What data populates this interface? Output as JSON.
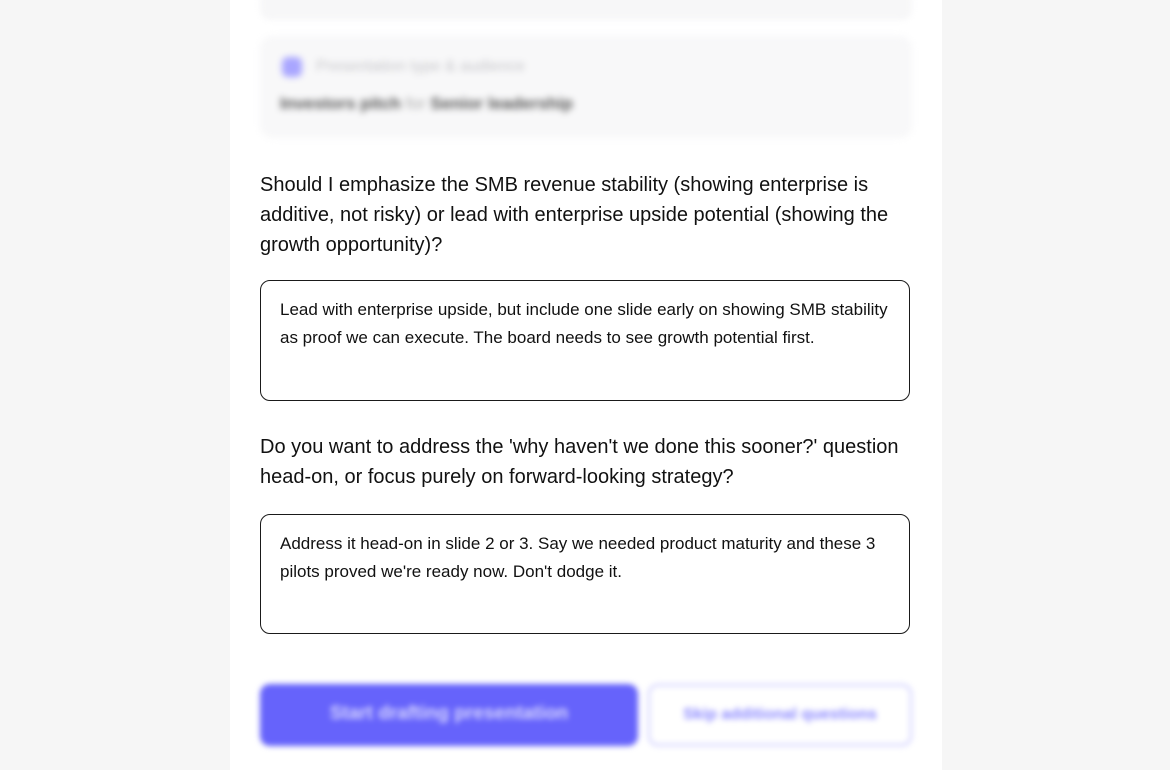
{
  "summary": {
    "top_strip_text": "",
    "type_label": "Presentation type & audience",
    "type_value": "Investors pitch",
    "type_connector": "for",
    "audience_value": "Senior leadership"
  },
  "questions": [
    {
      "question": "Should I emphasize the SMB revenue stability (showing enterprise is additive, not risky) or lead with enterprise upside potential (showing the growth opportunity)?",
      "answer": "Lead with enterprise upside, but include one slide early on showing SMB stability as proof we can execute. The board needs to see growth potential first."
    },
    {
      "question": "Do you want to address the 'why haven't we done this sooner?' question head-on, or focus purely on forward-looking strategy?",
      "answer": "Address it head-on in slide 2 or 3. Say we needed product maturity and these 3 pilots proved we're ready now. Don't dodge it."
    }
  ],
  "actions": {
    "primary_label": "Start drafting presentation",
    "secondary_label": "Skip additional questions"
  },
  "colors": {
    "accent": "#6663fb",
    "accent_light": "#cac9ff",
    "background": "#f6f6f6",
    "card": "#ffffff"
  }
}
